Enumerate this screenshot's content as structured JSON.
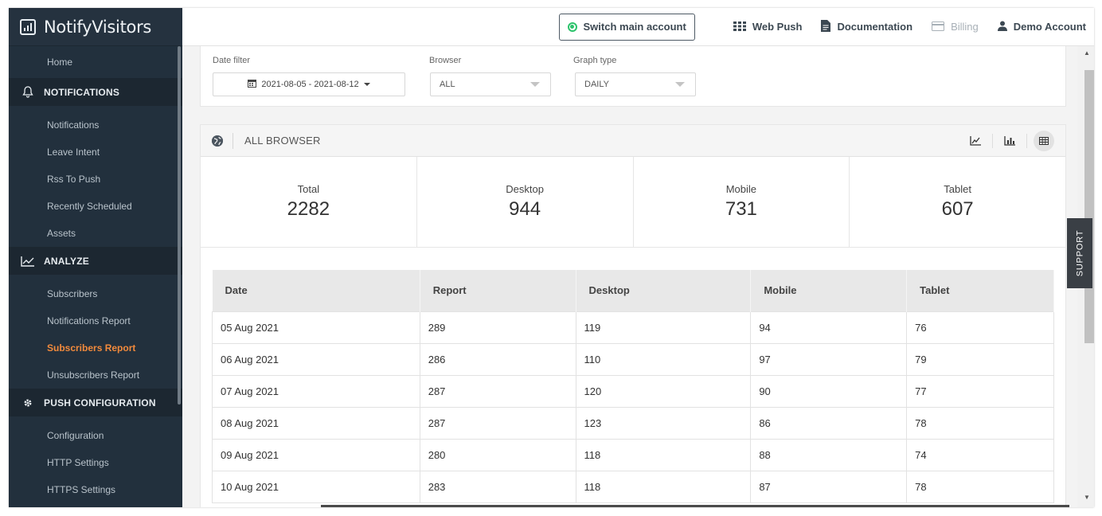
{
  "brand": {
    "name": "NotifyVisitors"
  },
  "header": {
    "switch_account": "Switch main account",
    "links": [
      {
        "label": "Web Push",
        "icon": "grid-icon"
      },
      {
        "label": "Documentation",
        "icon": "document-icon"
      },
      {
        "label": "Billing",
        "icon": "card-icon"
      },
      {
        "label": "Demo Account",
        "icon": "user-icon"
      }
    ]
  },
  "sidebar": {
    "home": "Home",
    "sections": [
      {
        "title": "NOTIFICATIONS",
        "icon": "bell-icon",
        "items": [
          "Notifications",
          "Leave Intent",
          "Rss To Push",
          "Recently Scheduled",
          "Assets"
        ]
      },
      {
        "title": "ANALYZE",
        "icon": "line-chart-icon",
        "items": [
          "Subscribers",
          "Notifications Report",
          "Subscribers Report",
          "Unsubscribers Report"
        ],
        "active": "Subscribers Report"
      },
      {
        "title": "PUSH CONFIGURATION",
        "icon": "gear-icon",
        "items": [
          "Configuration",
          "HTTP Settings",
          "HTTPS Settings"
        ]
      }
    ]
  },
  "filters": {
    "date_label": "Date filter",
    "date_value": "2021-08-05 - 2021-08-12",
    "browser_label": "Browser",
    "browser_value": "ALL",
    "graph_label": "Graph type",
    "graph_value": "DAILY"
  },
  "report": {
    "title": "ALL BROWSER",
    "stats": [
      {
        "label": "Total",
        "value": "2282"
      },
      {
        "label": "Desktop",
        "value": "944"
      },
      {
        "label": "Mobile",
        "value": "731"
      },
      {
        "label": "Tablet",
        "value": "607"
      }
    ],
    "columns": [
      "Date",
      "Report",
      "Desktop",
      "Mobile",
      "Tablet"
    ],
    "rows": [
      [
        "05 Aug 2021",
        "289",
        "119",
        "94",
        "76"
      ],
      [
        "06 Aug 2021",
        "286",
        "110",
        "97",
        "79"
      ],
      [
        "07 Aug 2021",
        "287",
        "120",
        "90",
        "77"
      ],
      [
        "08 Aug 2021",
        "287",
        "123",
        "86",
        "78"
      ],
      [
        "09 Aug 2021",
        "280",
        "118",
        "88",
        "74"
      ],
      [
        "10 Aug 2021",
        "283",
        "118",
        "87",
        "78"
      ]
    ]
  },
  "support": {
    "label": "SUPPORT"
  }
}
